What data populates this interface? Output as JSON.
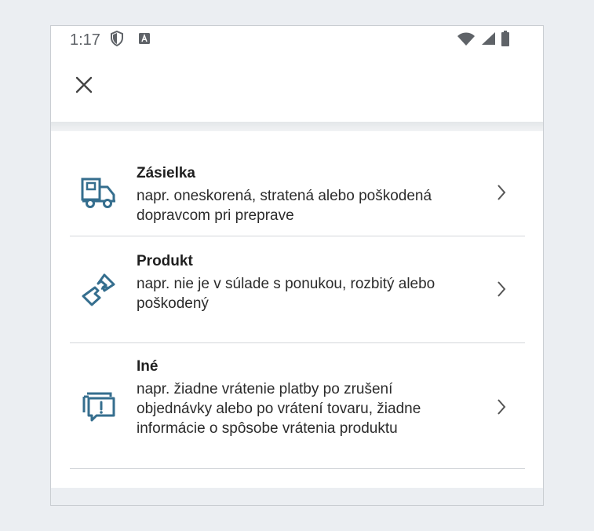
{
  "status_bar": {
    "time": "1:17"
  },
  "colors": {
    "icon_blue": "#356e8e",
    "text_dark": "#1f1f1f",
    "divider": "#d4d7db"
  },
  "icons": {
    "close": "close-icon",
    "shipment": "delivery-truck-icon",
    "product": "broken-product-icon",
    "other": "message-alert-icon",
    "chevron": "chevron-right-icon"
  },
  "items": [
    {
      "title": "Zásielka",
      "line1": "napr. oneskorená, stratená alebo poškodená",
      "line2": "dopravcom pri preprave"
    },
    {
      "title": "Produkt",
      "line1": "napr. nie je v súlade s ponukou, rozbitý alebo",
      "line2": "poškodený"
    },
    {
      "title": "Iné",
      "line1": "napr. žiadne vrátenie platby po zrušení",
      "line2": "objednávky alebo po vrátení tovaru, žiadne",
      "line3": "informácie o spôsobe vrátenia produktu"
    }
  ]
}
